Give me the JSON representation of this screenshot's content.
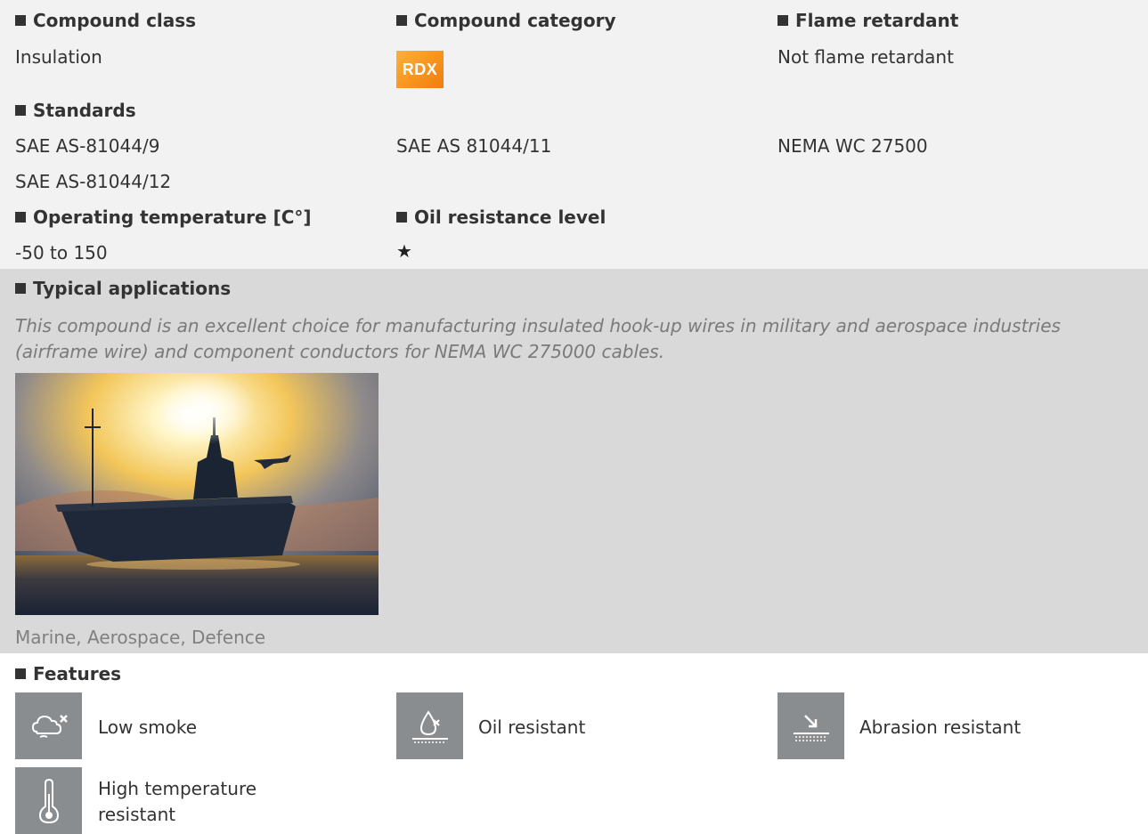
{
  "compound_class": {
    "heading": "Compound class",
    "value": "Insulation"
  },
  "compound_category": {
    "heading": "Compound category",
    "badge": "RDX"
  },
  "flame_retardant": {
    "heading": "Flame retardant",
    "value": "Not flame retardant"
  },
  "standards": {
    "heading": "Standards",
    "items": [
      "SAE AS-81044/9",
      "SAE AS 81044/11",
      "NEMA WC 27500",
      "SAE AS-81044/12"
    ]
  },
  "operating_temperature": {
    "heading": "Operating temperature [C°]",
    "value": "-50 to 150"
  },
  "oil_resistance": {
    "heading": "Oil resistance level",
    "stars": "★",
    "level": 1
  },
  "typical_applications": {
    "heading": "Typical applications",
    "text": "This compound is an excellent choice for manufacturing insulated hook-up wires in military and aerospace industries (airframe wire) and component conductors for NEMA WC 275000 cables.",
    "caption": "Marine, Aerospace, Defence"
  },
  "features": {
    "heading": "Features",
    "items": [
      {
        "label": "Low smoke",
        "icon": "low-smoke-icon"
      },
      {
        "label": "Oil resistant",
        "icon": "oil-resistant-icon"
      },
      {
        "label": "Abrasion resistant",
        "icon": "abrasion-resistant-icon"
      },
      {
        "label": "High temperature resistant",
        "icon": "high-temperature-icon"
      }
    ]
  },
  "colors": {
    "band_light": "#f2f2f2",
    "band_dark": "#d9d9d9",
    "icon_bg": "#8a8d8f",
    "badge_orange": "#f7941d"
  }
}
